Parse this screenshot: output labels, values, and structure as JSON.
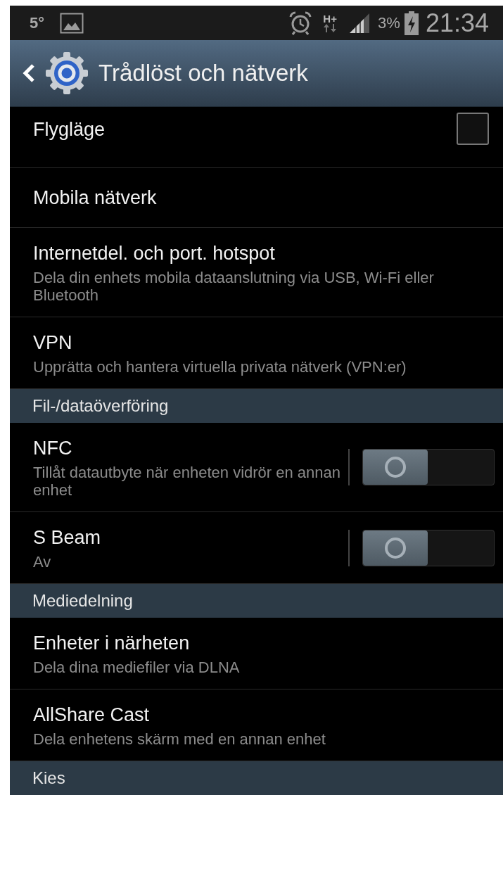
{
  "status_bar": {
    "temperature": "5°",
    "network_type": "H+",
    "battery": "3%",
    "time": "21:34"
  },
  "header": {
    "title": "Trådlöst och nätverk"
  },
  "rows": [
    {
      "kind": "checkbox",
      "title": "Flygläge",
      "checked": false
    },
    {
      "kind": "plain",
      "title": "Mobila nätverk"
    },
    {
      "kind": "plain",
      "title": "Internetdel. och port. hotspot",
      "subtitle": "Dela din enhets mobila dataanslutning via USB, Wi-Fi eller Bluetooth"
    },
    {
      "kind": "plain",
      "title": "VPN",
      "subtitle": "Upprätta och hantera virtuella privata nätverk (VPN:er)"
    },
    {
      "kind": "section",
      "title": "Fil-/dataöverföring"
    },
    {
      "kind": "switch",
      "title": "NFC",
      "subtitle": "Tillåt datautbyte när enheten vidrör en annan enhet",
      "on": false
    },
    {
      "kind": "switch",
      "title": "S Beam",
      "subtitle": "Av",
      "on": false
    },
    {
      "kind": "section",
      "title": "Mediedelning"
    },
    {
      "kind": "plain",
      "title": "Enheter i närheten",
      "subtitle": "Dela dina mediefiler via DLNA"
    },
    {
      "kind": "plain",
      "title": "AllShare Cast",
      "subtitle": "Dela enhetens skärm med en annan enhet"
    },
    {
      "kind": "section",
      "title": "Kies"
    }
  ]
}
